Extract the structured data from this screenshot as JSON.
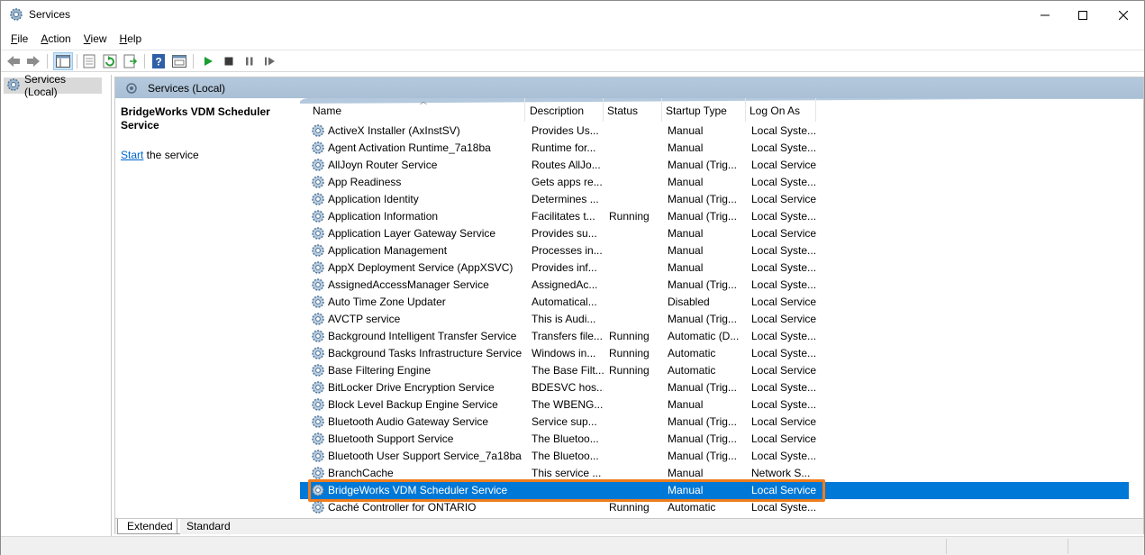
{
  "window": {
    "title": "Services"
  },
  "menu": [
    {
      "label": "File",
      "key": "F",
      "rest": "ile"
    },
    {
      "label": "Action",
      "key": "A",
      "rest": "ction"
    },
    {
      "label": "View",
      "key": "V",
      "rest": "iew"
    },
    {
      "label": "Help",
      "key": "H",
      "rest": "elp"
    }
  ],
  "toolbar": {
    "buttons": [
      "back-icon",
      "forward-icon",
      "show-hide-tree-icon",
      "properties-icon",
      "refresh-icon",
      "export-list-icon",
      "help-icon",
      "console-view-icon",
      "start-service-icon",
      "stop-service-icon",
      "pause-service-icon",
      "restart-service-icon"
    ]
  },
  "tree": {
    "root_label": "Services (Local)"
  },
  "pane": {
    "header": "Services (Local)",
    "selected_title": "BridgeWorks VDM Scheduler Service",
    "action_link": "Start",
    "action_rest": " the service"
  },
  "columns": {
    "name": "Name",
    "description": "Description",
    "status": "Status",
    "startup": "Startup Type",
    "logon": "Log On As"
  },
  "rows": [
    {
      "name": "ActiveX Installer (AxInstSV)",
      "description": "Provides Us...",
      "status": "",
      "startup": "Manual",
      "logon": "Local Syste..."
    },
    {
      "name": "Agent Activation Runtime_7a18ba",
      "description": "Runtime for...",
      "status": "",
      "startup": "Manual",
      "logon": "Local Syste..."
    },
    {
      "name": "AllJoyn Router Service",
      "description": "Routes AllJo...",
      "status": "",
      "startup": "Manual (Trig...",
      "logon": "Local Service"
    },
    {
      "name": "App Readiness",
      "description": "Gets apps re...",
      "status": "",
      "startup": "Manual",
      "logon": "Local Syste..."
    },
    {
      "name": "Application Identity",
      "description": "Determines ...",
      "status": "",
      "startup": "Manual (Trig...",
      "logon": "Local Service"
    },
    {
      "name": "Application Information",
      "description": "Facilitates t...",
      "status": "Running",
      "startup": "Manual (Trig...",
      "logon": "Local Syste..."
    },
    {
      "name": "Application Layer Gateway Service",
      "description": "Provides su...",
      "status": "",
      "startup": "Manual",
      "logon": "Local Service"
    },
    {
      "name": "Application Management",
      "description": "Processes in...",
      "status": "",
      "startup": "Manual",
      "logon": "Local Syste..."
    },
    {
      "name": "AppX Deployment Service (AppXSVC)",
      "description": "Provides inf...",
      "status": "",
      "startup": "Manual",
      "logon": "Local Syste..."
    },
    {
      "name": "AssignedAccessManager Service",
      "description": "AssignedAc...",
      "status": "",
      "startup": "Manual (Trig...",
      "logon": "Local Syste..."
    },
    {
      "name": "Auto Time Zone Updater",
      "description": "Automatical...",
      "status": "",
      "startup": "Disabled",
      "logon": "Local Service"
    },
    {
      "name": "AVCTP service",
      "description": "This is Audi...",
      "status": "",
      "startup": "Manual (Trig...",
      "logon": "Local Service"
    },
    {
      "name": "Background Intelligent Transfer Service",
      "description": "Transfers file...",
      "status": "Running",
      "startup": "Automatic (D...",
      "logon": "Local Syste..."
    },
    {
      "name": "Background Tasks Infrastructure Service",
      "description": "Windows in...",
      "status": "Running",
      "startup": "Automatic",
      "logon": "Local Syste..."
    },
    {
      "name": "Base Filtering Engine",
      "description": "The Base Filt...",
      "status": "Running",
      "startup": "Automatic",
      "logon": "Local Service"
    },
    {
      "name": "BitLocker Drive Encryption Service",
      "description": "BDESVC hos...",
      "status": "",
      "startup": "Manual (Trig...",
      "logon": "Local Syste..."
    },
    {
      "name": "Block Level Backup Engine Service",
      "description": "The WBENG...",
      "status": "",
      "startup": "Manual",
      "logon": "Local Syste..."
    },
    {
      "name": "Bluetooth Audio Gateway Service",
      "description": "Service sup...",
      "status": "",
      "startup": "Manual (Trig...",
      "logon": "Local Service"
    },
    {
      "name": "Bluetooth Support Service",
      "description": "The Bluetoo...",
      "status": "",
      "startup": "Manual (Trig...",
      "logon": "Local Service"
    },
    {
      "name": "Bluetooth User Support Service_7a18ba",
      "description": "The Bluetoo...",
      "status": "",
      "startup": "Manual (Trig...",
      "logon": "Local Syste..."
    },
    {
      "name": "BranchCache",
      "description": "This service ...",
      "status": "",
      "startup": "Manual",
      "logon": "Network S..."
    },
    {
      "name": "BridgeWorks VDM Scheduler Service",
      "description": "",
      "status": "",
      "startup": "Manual",
      "logon": "Local Service",
      "selected": true
    },
    {
      "name": "Caché Controller for ONTARIO",
      "description": "",
      "status": "Running",
      "startup": "Automatic",
      "logon": "Local Syste..."
    }
  ],
  "tabs": [
    "Extended",
    "Standard"
  ],
  "colors": {
    "selection": "#0078d7",
    "highlight_outline": "#f07d1b",
    "header_band": "#b4c9dd"
  }
}
